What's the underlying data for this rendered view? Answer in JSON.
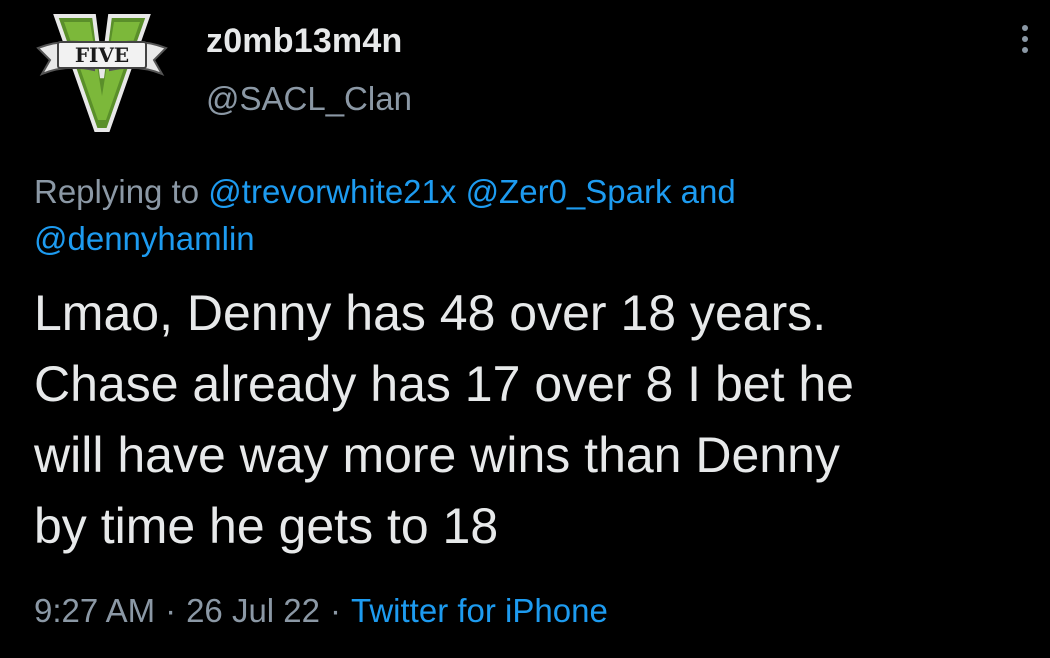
{
  "user": {
    "display_name": "z0mb13m4n",
    "handle": "@SACL_Clan",
    "avatar_icon": "gta-five-logo-icon",
    "avatar_text": "FIVE"
  },
  "reply": {
    "prefix": "Replying to",
    "mentions": [
      "@trevorwhite21x",
      "@Zer0_Spark"
    ],
    "conjunction": "and",
    "last_mention": "@dennyhamlin"
  },
  "tweet": {
    "lines": [
      "Lmao, Denny has 48 over 18 years.",
      "Chase already has 17 over 8 I bet he",
      "will have way more wins than Denny",
      "by time he gets to 18"
    ]
  },
  "meta": {
    "time": "9:27 AM",
    "separator": "·",
    "date": "26 Jul 22",
    "source": "Twitter for iPhone"
  },
  "colors": {
    "background": "#000000",
    "text": "#e7e9ea",
    "secondary": "#8b98a5",
    "link": "#1d9bf0",
    "logo_green": "#6fa832"
  }
}
